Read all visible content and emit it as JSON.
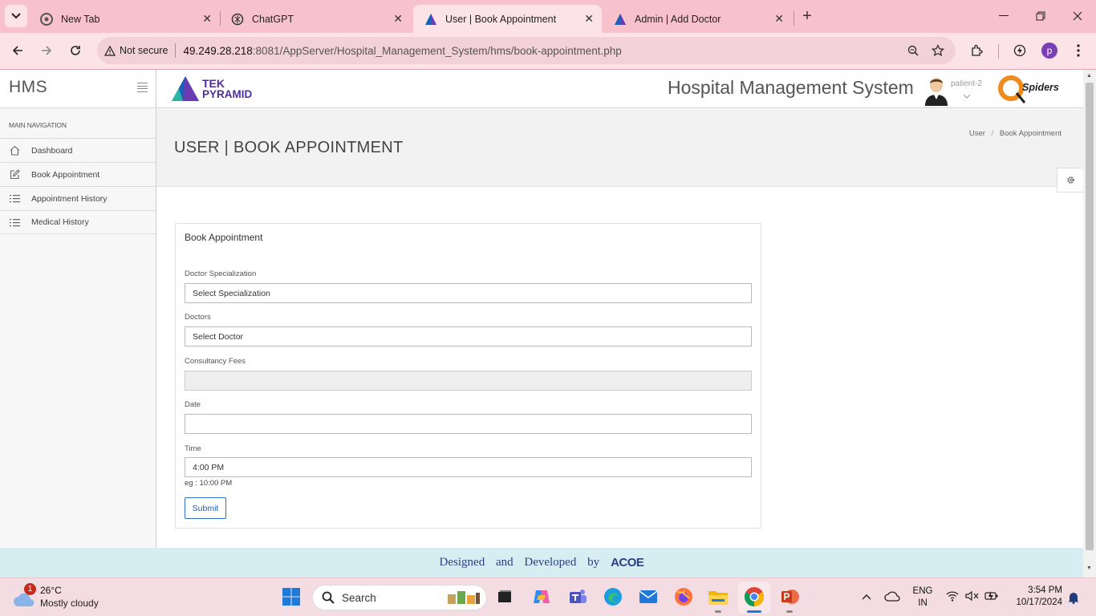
{
  "browser": {
    "tabs": [
      {
        "label": "New Tab",
        "icon": "chrome-icon"
      },
      {
        "label": "ChatGPT",
        "icon": "openai-icon"
      },
      {
        "label": "User | Book Appointment",
        "icon": "triangle-logo-icon",
        "active": true
      },
      {
        "label": "Admin | Add Doctor",
        "icon": "triangle-logo-icon"
      }
    ],
    "not_secure": "Not secure",
    "url_host": "49.249.28.218",
    "url_rest": ":8081/AppServer/Hospital_Management_System/hms/book-appointment.php",
    "profile_initial": "p"
  },
  "sidebar": {
    "brand": "HMS",
    "nav_label": "MAIN NAVIGATION",
    "items": [
      {
        "label": "Dashboard",
        "icon": "home-icon"
      },
      {
        "label": "Book Appointment",
        "icon": "edit-icon"
      },
      {
        "label": "Appointment History",
        "icon": "list-icon"
      },
      {
        "label": "Medical History",
        "icon": "list-icon"
      }
    ]
  },
  "header": {
    "logo_line1": "TEK",
    "logo_line2": "PYRAMID",
    "app_name": "Hospital Management System",
    "username": "patient-2",
    "partner_logo": "Spiders"
  },
  "page": {
    "title": "USER | BOOK APPOINTMENT",
    "breadcrumb": [
      "User",
      "Book Appointment"
    ],
    "breadcrumb_sep": "/"
  },
  "form": {
    "panel_title": "Book Appointment",
    "specialization_label": "Doctor Specialization",
    "specialization_value": "Select Specialization",
    "doctors_label": "Doctors",
    "doctors_value": "Select Doctor",
    "fees_label": "Consultancy Fees",
    "fees_value": "",
    "date_label": "Date",
    "date_value": "",
    "time_label": "Time",
    "time_value": "4:00 PM",
    "time_hint": "eg : 10:00 PM",
    "submit_label": "Submit"
  },
  "footer": {
    "text": "Designed and Developed by",
    "logo": "ACOE"
  },
  "taskbar": {
    "weather_temp": "26°C",
    "weather_desc": "Mostly cloudy",
    "weather_badge": "1",
    "search_label": "Search",
    "lang_line1": "ENG",
    "lang_line2": "IN",
    "time": "3:54 PM",
    "date": "10/17/2024"
  },
  "colors": {
    "tab_bar": "#f8c2cc",
    "toolbar": "#fbe3e8",
    "footer_bg": "#d6eef1",
    "accent_blue": "#1f5fb2"
  }
}
